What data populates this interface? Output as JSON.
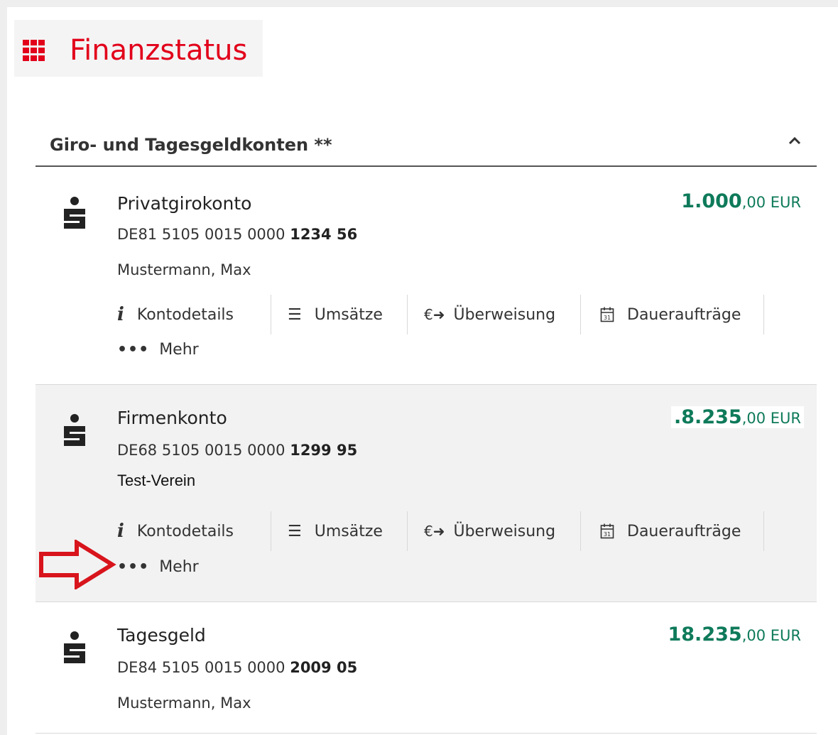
{
  "page": {
    "title": "Finanzstatus",
    "title_icon": "grid-icon",
    "accent_color": "#e2001a"
  },
  "section": {
    "title": "Giro- und Tagesgeldkonten **",
    "collapse_icon": "chevron-up-icon"
  },
  "actions": {
    "details": "Kontodetails",
    "transactions": "Umsätze",
    "transfer": "Überweisung",
    "standing_orders": "Daueraufträge",
    "more": "Mehr",
    "details_icon": "info-icon",
    "transactions_icon": "list-icon",
    "transfer_icon": "euro-arrow-icon",
    "standing_orders_icon": "calendar-icon",
    "more_icon": "dots-icon"
  },
  "accounts": [
    {
      "name": "Privatgirokonto",
      "iban_prefix": "DE81 5105 0015 0000 ",
      "iban_suffix": "1234 56",
      "holder": "Mustermann, Max",
      "balance_int": "1.000",
      "balance_dec": ",00 EUR"
    },
    {
      "name": "Firmenkonto",
      "iban_prefix": "DE68 5105 0015 0000 ",
      "iban_suffix": "1299 95",
      "holder": "Test-Verein",
      "balance_int": ".8.235",
      "balance_dec": ",00 EUR"
    },
    {
      "name": "Tagesgeld",
      "iban_prefix": "DE84 5105 0015 0000 ",
      "iban_suffix": "2009 05",
      "holder": "Mustermann, Max",
      "balance_int": "18.235",
      "balance_dec": ",00 EUR"
    }
  ],
  "colors": {
    "balance": "#0e7a5a",
    "annotation_arrow": "#d8141c"
  }
}
